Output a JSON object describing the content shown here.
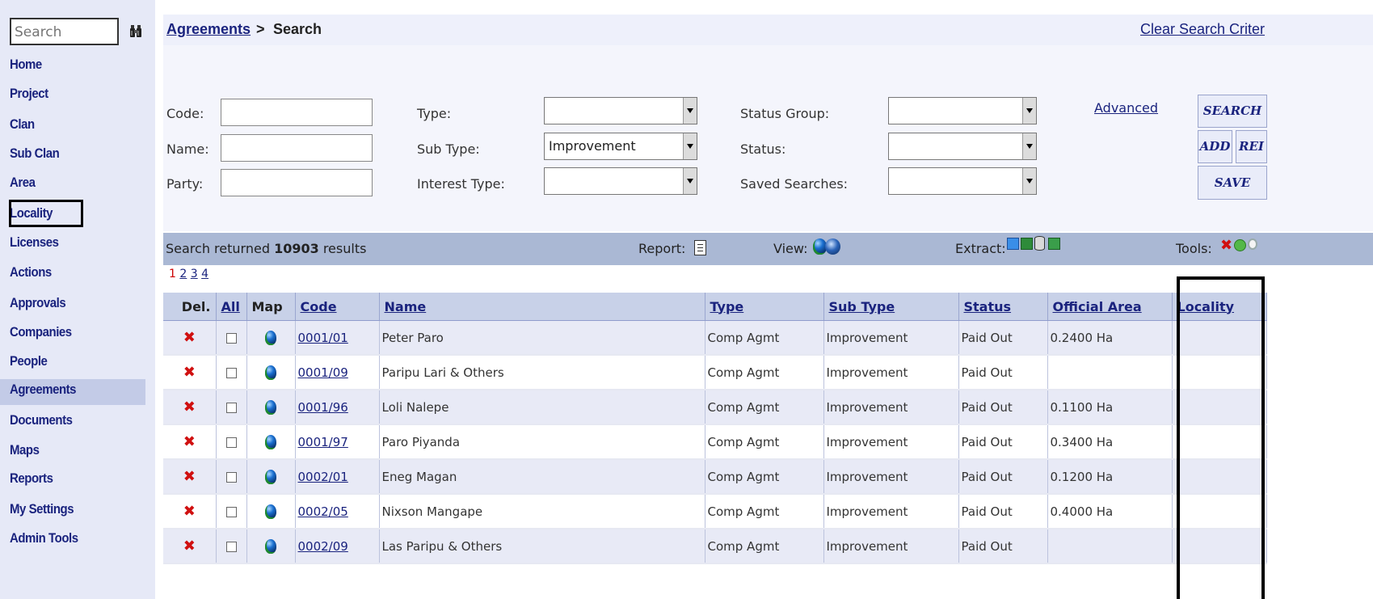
{
  "sidebar": {
    "search_placeholder": "Search",
    "items": [
      {
        "label": "Home"
      },
      {
        "label": "Project"
      },
      {
        "label": "Clan"
      },
      {
        "label": "Sub Clan"
      },
      {
        "label": "Area"
      },
      {
        "label": "Locality"
      },
      {
        "label": "Licenses"
      },
      {
        "label": "Actions"
      },
      {
        "label": "Approvals"
      },
      {
        "label": "Companies"
      },
      {
        "label": "People"
      },
      {
        "label": "Agreements"
      },
      {
        "label": "Documents"
      },
      {
        "label": "Maps"
      },
      {
        "label": "Reports"
      },
      {
        "label": "My Settings"
      },
      {
        "label": "Admin Tools"
      }
    ],
    "active_item": "Agreements",
    "highlighted_item": "Locality"
  },
  "breadcrumb": {
    "root": "Agreements",
    "separator": ">",
    "current": "Search"
  },
  "clear_link": "Clear Search Criter",
  "form": {
    "code_label": "Code:",
    "name_label": "Name:",
    "party_label": "Party:",
    "code_value": "",
    "name_value": "",
    "party_value": "",
    "type_label": "Type:",
    "subtype_label": "Sub Type:",
    "interest_label": "Interest Type:",
    "type_value": "",
    "subtype_value": "Improvement",
    "interest_value": "",
    "status_group_label": "Status Group:",
    "status_label": "Status:",
    "saved_label": "Saved Searches:",
    "status_group_value": "",
    "status_value": "",
    "saved_value": "",
    "advanced": "Advanced"
  },
  "buttons": {
    "search": "SEARCH",
    "add": "ADD",
    "reset": "REI",
    "save": "SAVE"
  },
  "results": {
    "prefix": "Search returned ",
    "count": "10903",
    "suffix": " results",
    "report_label": "Report:",
    "view_label": "View:",
    "extract_label": "Extract:",
    "tools_label": "Tools:"
  },
  "pagination": {
    "current": "1",
    "pages": [
      "2",
      "3",
      "4"
    ]
  },
  "table": {
    "headers": {
      "del": "Del.",
      "all": "All",
      "map": "Map",
      "code": "Code",
      "name": "Name",
      "type": "Type",
      "subtype": "Sub Type",
      "status": "Status",
      "area": "Official Area",
      "locality": "Locality"
    },
    "rows": [
      {
        "code": "0001/01",
        "name": "Peter Paro",
        "type": "Comp Agmt",
        "subtype": "Improvement",
        "status": "Paid Out",
        "area": "0.2400 Ha",
        "locality": ""
      },
      {
        "code": "0001/09",
        "name": "Paripu Lari & Others",
        "type": "Comp Agmt",
        "subtype": "Improvement",
        "status": "Paid Out",
        "area": "",
        "locality": ""
      },
      {
        "code": "0001/96",
        "name": "Loli Nalepe",
        "type": "Comp Agmt",
        "subtype": "Improvement",
        "status": "Paid Out",
        "area": "0.1100 Ha",
        "locality": ""
      },
      {
        "code": "0001/97",
        "name": "Paro Piyanda",
        "type": "Comp Agmt",
        "subtype": "Improvement",
        "status": "Paid Out",
        "area": "0.3400 Ha",
        "locality": ""
      },
      {
        "code": "0002/01",
        "name": "Eneg Magan",
        "type": "Comp Agmt",
        "subtype": "Improvement",
        "status": "Paid Out",
        "area": "0.1200 Ha",
        "locality": ""
      },
      {
        "code": "0002/05",
        "name": "Nixson Mangape",
        "type": "Comp Agmt",
        "subtype": "Improvement",
        "status": "Paid Out",
        "area": "0.4000 Ha",
        "locality": ""
      },
      {
        "code": "0002/09",
        "name": "Las Paripu & Others",
        "type": "Comp Agmt",
        "subtype": "Improvement",
        "status": "Paid Out",
        "area": "",
        "locality": ""
      }
    ]
  },
  "colors": {
    "sidebar_bg": "#e6e9f7",
    "nav_text": "#1a237e",
    "delete_red": "#d01010",
    "header_row": "#c8d1e8"
  }
}
